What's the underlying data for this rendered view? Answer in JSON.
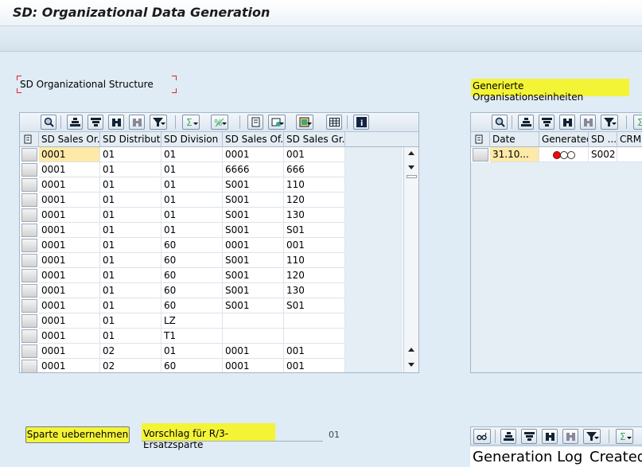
{
  "window": {
    "title": "SD: Organizational Data Generation"
  },
  "left_section": {
    "title": "SD Organizational Structure",
    "columns": [
      "SD Sales Or...",
      "SD Distributi...",
      "SD Division",
      "SD Sales Of...",
      "SD Sales Gr..."
    ],
    "rows": [
      [
        "0001",
        "01",
        "01",
        "0001",
        "001"
      ],
      [
        "0001",
        "01",
        "01",
        "6666",
        "666"
      ],
      [
        "0001",
        "01",
        "01",
        "S001",
        "110"
      ],
      [
        "0001",
        "01",
        "01",
        "S001",
        "120"
      ],
      [
        "0001",
        "01",
        "01",
        "S001",
        "130"
      ],
      [
        "0001",
        "01",
        "01",
        "S001",
        "S01"
      ],
      [
        "0001",
        "01",
        "60",
        "0001",
        "001"
      ],
      [
        "0001",
        "01",
        "60",
        "S001",
        "110"
      ],
      [
        "0001",
        "01",
        "60",
        "S001",
        "120"
      ],
      [
        "0001",
        "01",
        "60",
        "S001",
        "130"
      ],
      [
        "0001",
        "01",
        "60",
        "S001",
        "S01"
      ],
      [
        "0001",
        "01",
        "LZ",
        "",
        ""
      ],
      [
        "0001",
        "01",
        "T1",
        "",
        ""
      ],
      [
        "0001",
        "02",
        "01",
        "0001",
        "001"
      ],
      [
        "0001",
        "02",
        "60",
        "0001",
        "001"
      ]
    ],
    "toolbar_icons": [
      "details-icon",
      "sort-ascending-icon",
      "sort-descending-icon",
      "find-icon",
      "find-next-icon",
      "filter-icon",
      "sum-icon",
      "subtotal-icon",
      "print-preview-icon",
      "export-icon",
      "layout-icon",
      "grid-view-icon",
      "information-icon"
    ]
  },
  "right_section": {
    "title": "Generierte Organisationseinheiten",
    "columns": [
      "Date",
      "Generated",
      "SD ...",
      "CRM S"
    ],
    "rows": [
      {
        "date": "31.10...",
        "generated_status": "red",
        "sd": "S002",
        "crm": ""
      }
    ]
  },
  "bottom": {
    "button_label": "Sparte uebernehmen",
    "proposal_label": "Vorschlag für R/3-Ersatzsparte",
    "proposal_value": "01",
    "log_headers": [
      "Generation Log",
      "Created"
    ]
  },
  "colors": {
    "highlight": "#f4f436",
    "background": "#dfebf5",
    "focus_cell": "#fde9a8",
    "status_red": "#e41010"
  }
}
